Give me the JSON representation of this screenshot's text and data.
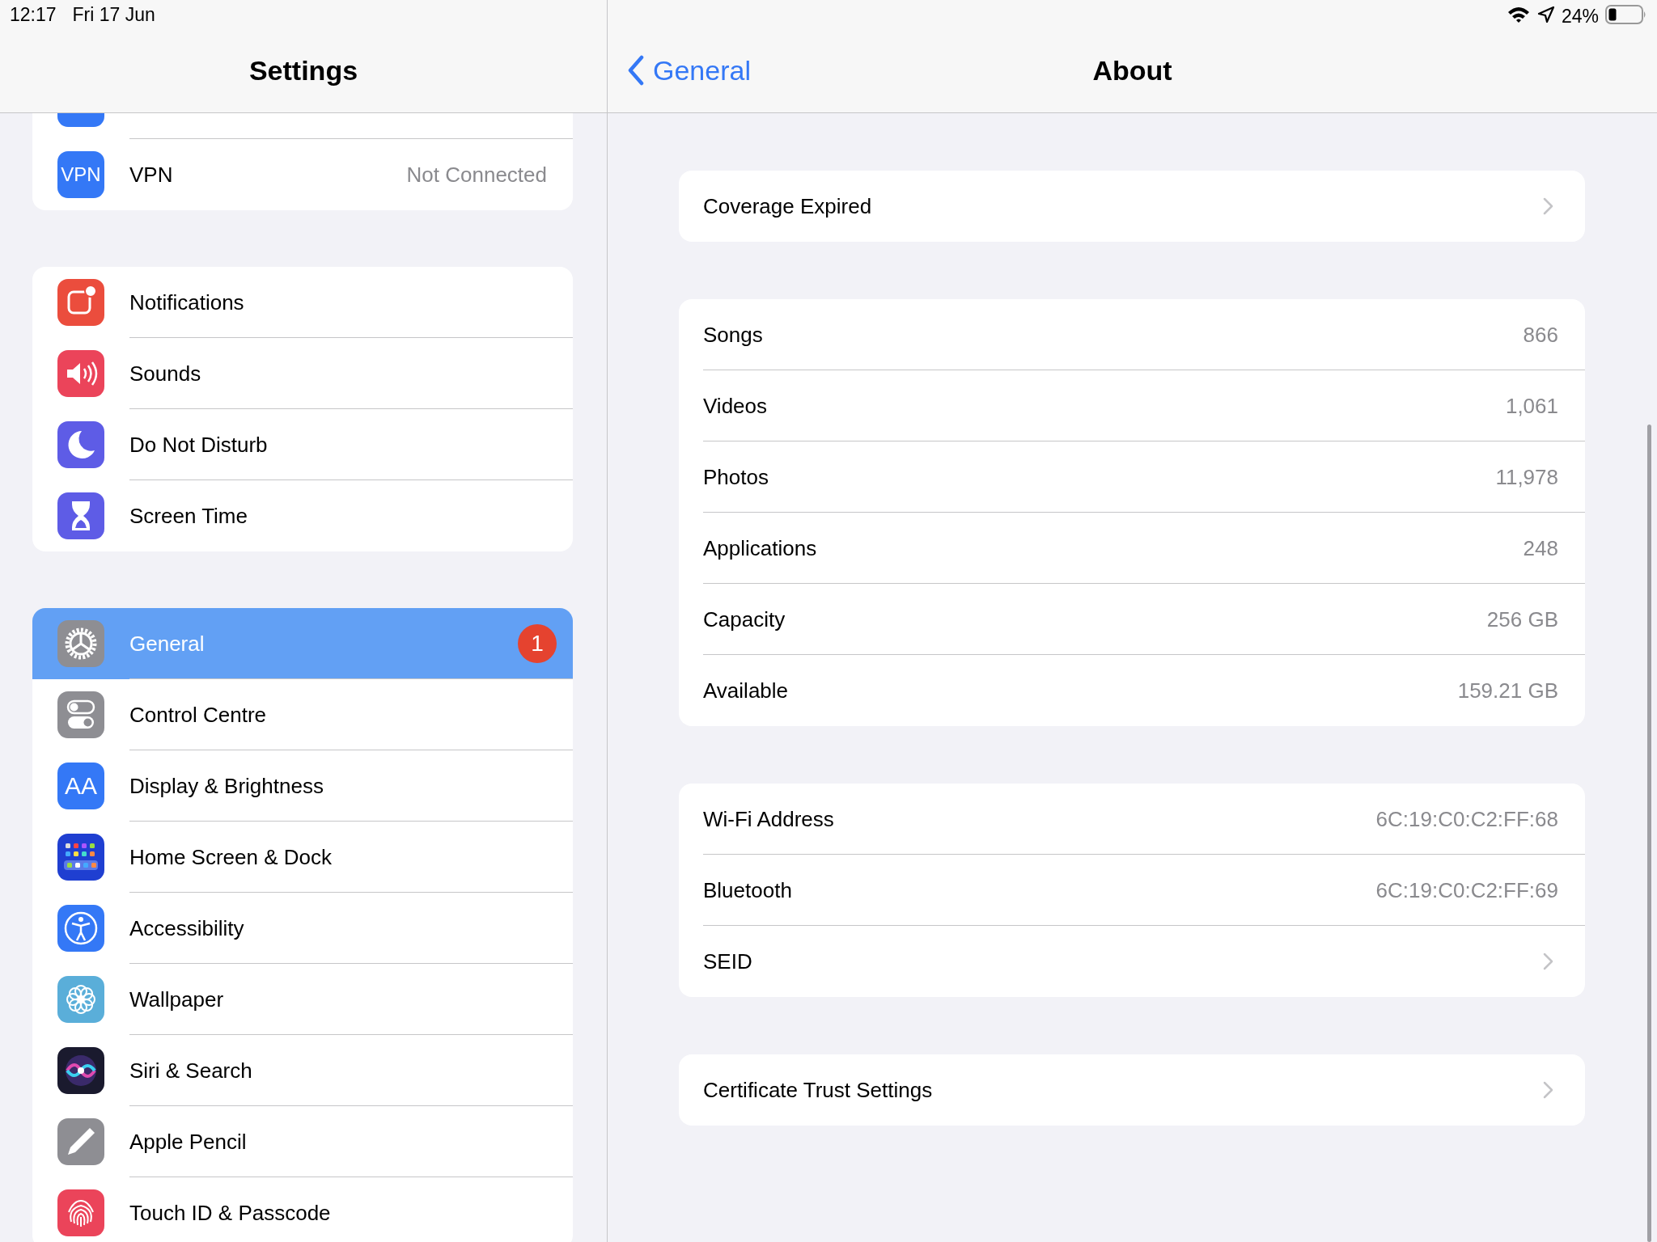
{
  "status_bar": {
    "time": "12:17",
    "date": "Fri 17 Jun",
    "battery": "24%"
  },
  "sidebar": {
    "title": "Settings",
    "groups": [
      {
        "items": [
          {
            "kind": "vpn",
            "icon_text": "VPN",
            "label": "VPN",
            "value": "Not Connected",
            "selected": false
          }
        ]
      },
      {
        "items": [
          {
            "kind": "notifications",
            "label": "Notifications",
            "selected": false
          },
          {
            "kind": "sounds",
            "label": "Sounds",
            "selected": false
          },
          {
            "kind": "moon",
            "label": "Do Not Disturb",
            "selected": false
          },
          {
            "kind": "hourglass",
            "label": "Screen Time",
            "selected": false
          }
        ]
      },
      {
        "items": [
          {
            "kind": "gear",
            "label": "General",
            "badge": "1",
            "selected": true
          },
          {
            "kind": "toggles",
            "label": "Control Centre",
            "selected": false
          },
          {
            "kind": "text",
            "icon_text": "AA",
            "label": "Display & Brightness",
            "selected": false
          },
          {
            "kind": "grid",
            "label": "Home Screen & Dock",
            "selected": false
          },
          {
            "kind": "accessibility",
            "label": "Accessibility",
            "selected": false
          },
          {
            "kind": "flower",
            "label": "Wallpaper",
            "selected": false
          },
          {
            "kind": "siri",
            "label": "Siri & Search",
            "selected": false
          },
          {
            "kind": "pencil",
            "label": "Apple Pencil",
            "selected": false
          },
          {
            "kind": "fingerprint",
            "label": "Touch ID & Passcode",
            "selected": false
          }
        ]
      }
    ]
  },
  "detail": {
    "back": "General",
    "title": "About",
    "groups": [
      {
        "rows": [
          {
            "label": "Coverage Expired",
            "chevron": true
          }
        ]
      },
      {
        "rows": [
          {
            "label": "Songs",
            "value": "866"
          },
          {
            "label": "Videos",
            "value": "1,061"
          },
          {
            "label": "Photos",
            "value": "11,978"
          },
          {
            "label": "Applications",
            "value": "248"
          },
          {
            "label": "Capacity",
            "value": "256 GB"
          },
          {
            "label": "Available",
            "value": "159.21 GB"
          }
        ]
      },
      {
        "rows": [
          {
            "label": "Wi-Fi Address",
            "value": "6C:19:C0:C2:FF:68"
          },
          {
            "label": "Bluetooth",
            "value": "6C:19:C0:C2:FF:69"
          },
          {
            "label": "SEID",
            "chevron": true
          }
        ]
      },
      {
        "rows": [
          {
            "label": "Certificate Trust Settings",
            "chevron": true
          }
        ]
      }
    ]
  }
}
